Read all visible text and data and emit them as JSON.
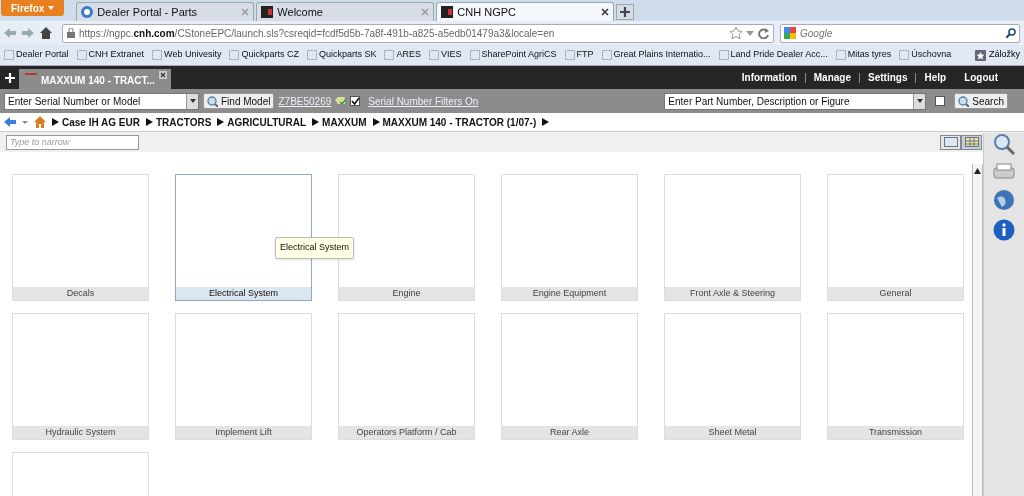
{
  "browser": {
    "menu_button": "Firefox",
    "tabs": [
      {
        "title": "Dealer Portal - Parts",
        "selected": false
      },
      {
        "title": "Welcome",
        "selected": false
      },
      {
        "title": "CNH NGPC",
        "selected": true
      }
    ],
    "url": {
      "prefix": "https://ngpc.",
      "domain": "cnh.com",
      "rest": "/CStoneEPC/launch.sls?csreqid=fcdf5d5b-7a8f-491b-a825-a5edb01479a3&locale=en"
    },
    "search_placeholder": "Google",
    "bookmarks": [
      {
        "label": "Dealer Portal"
      },
      {
        "label": "CNH Extranet"
      },
      {
        "label": "Web Univesity"
      },
      {
        "label": "Quickparts CZ"
      },
      {
        "label": "Quickparts SK"
      },
      {
        "label": "ARES"
      },
      {
        "label": "VIES"
      },
      {
        "label": "SharePoint AgriCS"
      },
      {
        "label": "FTP"
      },
      {
        "label": "Great Plains Internatio..."
      },
      {
        "label": "Land Pride Dealer Acc..."
      },
      {
        "label": "Mitas tyres"
      },
      {
        "label": "Úschovna"
      }
    ],
    "bookmarks_menu": "Záložky"
  },
  "app": {
    "document_tab": "MAXXUM 140 - TRACT...",
    "menu": [
      "Information",
      "Manage",
      "Settings",
      "Help",
      "Logout"
    ],
    "serial_field": {
      "placeholder": "Enter Serial Number or Model"
    },
    "find_button": "Find Model",
    "serial_number": "Z7BE50269",
    "serial_filter": {
      "checked": true,
      "label": "Serial Number Filters On"
    },
    "part_search": {
      "placeholder": "Enter Part Number, Description or Figure"
    },
    "part_search_option": {
      "checked": false
    },
    "search_button": "Search",
    "breadcrumb": [
      "Case IH AG EUR",
      "TRACTORS",
      "AGRICULTURAL",
      "MAXXUM",
      "MAXXUM 140 - TRACTOR (1/07-)"
    ],
    "narrow_field": {
      "placeholder": "Type to narrow"
    },
    "view_toggles": [
      {
        "selected": false
      },
      {
        "selected": true
      }
    ],
    "categories": [
      {
        "label": "Decals",
        "selected": false
      },
      {
        "label": "Electrical System",
        "selected": true
      },
      {
        "label": "Engine",
        "selected": false
      },
      {
        "label": "Engine Equipment",
        "selected": false
      },
      {
        "label": "Front Axle & Steering",
        "selected": false
      },
      {
        "label": "General",
        "selected": false
      },
      {
        "label": "Hydraulic System",
        "selected": false
      },
      {
        "label": "Implement Lift",
        "selected": false
      },
      {
        "label": "Operators Platform / Cab",
        "selected": false
      },
      {
        "label": "Rear Axle",
        "selected": false
      },
      {
        "label": "Sheet Metal",
        "selected": false
      },
      {
        "label": "Transmission",
        "selected": false
      },
      {
        "selected": false
      }
    ],
    "tooltip": "Electrical System"
  }
}
